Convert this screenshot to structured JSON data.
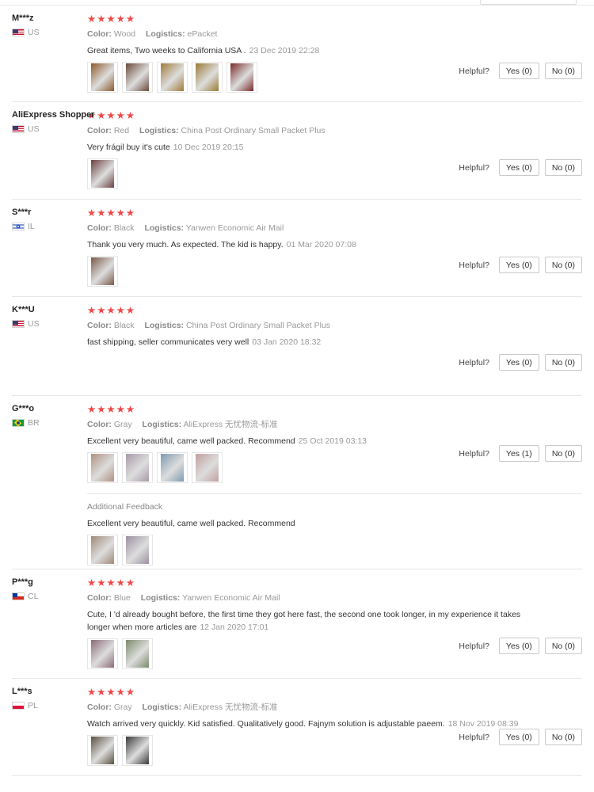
{
  "helpful_label": "Helpful?",
  "rating_stars": "★★★★★",
  "labels": {
    "color": "Color:",
    "logistics": "Logistics:",
    "additional": "Additional Feedback"
  },
  "colors": {
    "star": "#f04847",
    "meta": "#999999",
    "border": "#e6e6e6"
  },
  "reviews": [
    {
      "user": "M***z",
      "country": "US",
      "flag": "us",
      "color": "Wood",
      "logistics": "ePacket",
      "text": "Great items, Two weeks to California USA .",
      "date": "23 Dec 2019 22:28",
      "yes": "Yes (0)",
      "no": "No (0)",
      "photos": [
        "#8b5a2b",
        "#6b4a3a",
        "#a07a3a",
        "#9a7a35",
        "#7a2a2a"
      ]
    },
    {
      "user": "AliExpress Shopper",
      "country": "US",
      "flag": "us",
      "color": "Red",
      "logistics": "China Post Ordinary Small Packet Plus",
      "text": "Very frágil buy it's cute",
      "date": "10 Dec 2019 20:15",
      "yes": "Yes (0)",
      "no": "No (0)",
      "photos": [
        "#6b4040"
      ]
    },
    {
      "user": "S***r",
      "country": "IL",
      "flag": "il",
      "color": "Black",
      "logistics": "Yanwen Economic Air Mail",
      "text": "Thank you very much. As expected. The kid is happy.",
      "date": "01 Mar 2020 07:08",
      "yes": "Yes (0)",
      "no": "No (0)",
      "photos": [
        "#7a5a4a"
      ]
    },
    {
      "user": "K***U",
      "country": "US",
      "flag": "us",
      "color": "Black",
      "logistics": "China Post Ordinary Small Packet Plus",
      "text": "fast shipping, seller communicates very well",
      "date": "03 Jan 2020 18:32",
      "yes": "Yes (0)",
      "no": "No (0)",
      "photos": []
    },
    {
      "user": "G***o",
      "country": "BR",
      "flag": "br",
      "color": "Gray",
      "logistics": "AliExpress 无忧物流-标准",
      "text": "Excellent very beautiful, came well packed. Recommend",
      "date": "25 Oct 2019 03:13",
      "yes": "Yes (1)",
      "no": "No (0)",
      "photos": [
        "#b09080",
        "#a89aa8",
        "#7d9ab0",
        "#c0a0a0"
      ],
      "additional": {
        "text": "Excellent very beautiful, came well packed. Recommend",
        "photos": [
          "#a08878",
          "#9a90a0"
        ]
      }
    },
    {
      "user": "P***g",
      "country": "CL",
      "flag": "cl",
      "color": "Blue",
      "logistics": "Yanwen Economic Air Mail",
      "text": "Cute, I 'd already bought before, the first time they got here fast, the second one took longer, in my experience it takes longer when more articles are",
      "date": "12 Jan 2020 17:01",
      "yes": "Yes (0)",
      "no": "No (0)",
      "photos": [
        "#8a6a78",
        "#7a8a6a"
      ]
    },
    {
      "user": "L***s",
      "country": "PL",
      "flag": "pl",
      "color": "Gray",
      "logistics": "AliExpress 无忧物流-标准",
      "text": "Watch arrived very quickly. Kid satisfied. Qualitatively good. Fajnym solution is adjustable paeem.",
      "date": "18 Nov 2019 08:39",
      "yes": "Yes (0)",
      "no": "No (0)",
      "photos": [
        "#5a5040",
        "#3a3a3a"
      ]
    }
  ]
}
